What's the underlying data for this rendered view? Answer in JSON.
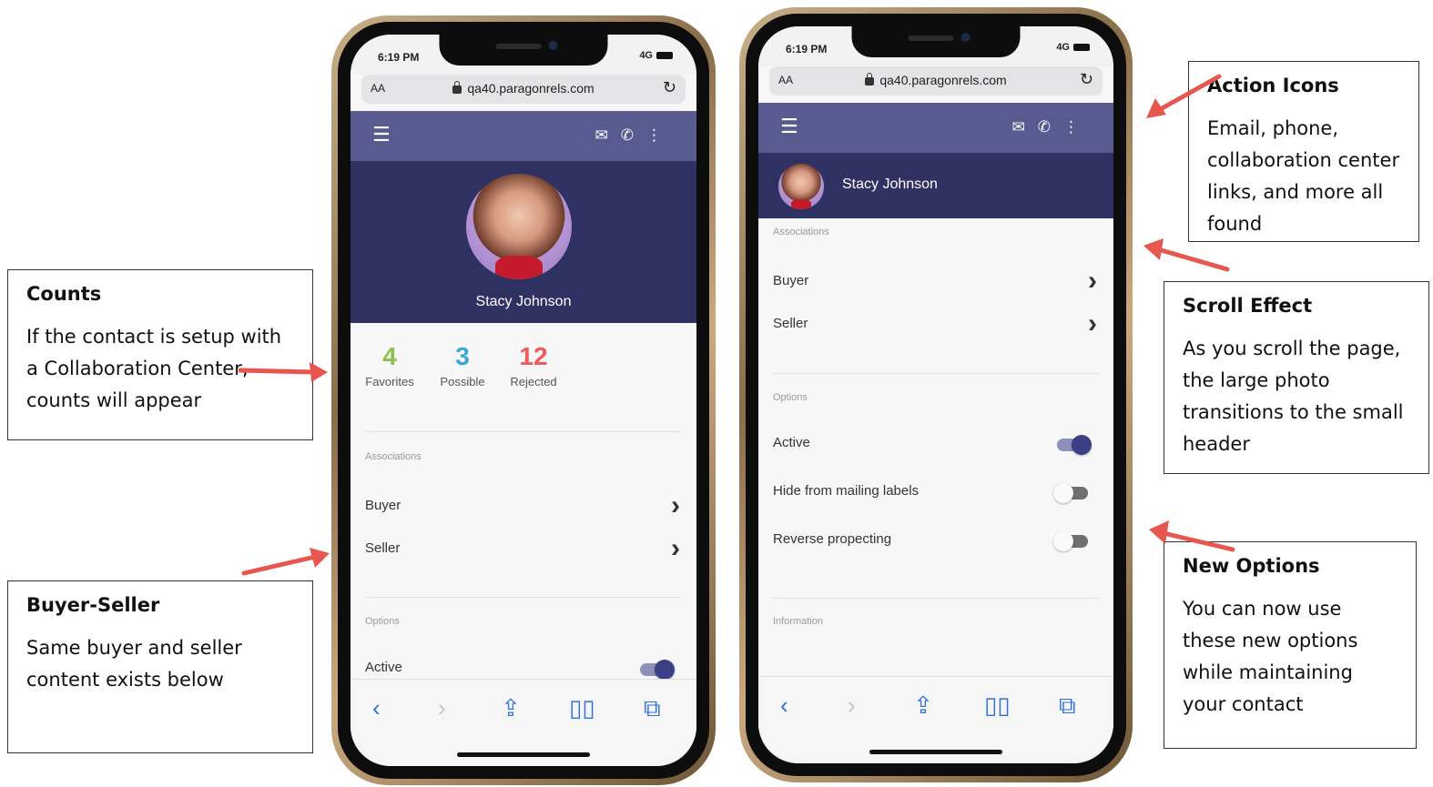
{
  "callouts": {
    "counts": {
      "title": "Counts",
      "text": "If the contact is setup with a Collaboration Center, counts will appear"
    },
    "buyer_seller": {
      "title": "Buyer-Seller",
      "text": "Same buyer and seller content exists below"
    },
    "action_icons": {
      "title": "Action Icons",
      "text": "Email, phone, collaboration center links, and more all found"
    },
    "scroll_effect": {
      "title": "Scroll Effect",
      "text": "As you scroll the page, the large photo transitions to the small header"
    },
    "new_options": {
      "title": "New Options",
      "text": "You can now use these new options while maintaining your contact"
    }
  },
  "status": {
    "time": "6:19 PM",
    "signal": "4G"
  },
  "browser": {
    "aa": "AA",
    "url": "qa40.paragonrels.com"
  },
  "contact": {
    "name": "Stacy Johnson"
  },
  "counts": {
    "favorites": {
      "value": "4",
      "label": "Favorites",
      "color": "#8bc34a"
    },
    "possible": {
      "value": "3",
      "label": "Possible",
      "color": "#3aa7d8"
    },
    "rejected": {
      "value": "12",
      "label": "Rejected",
      "color": "#ef5a5a"
    }
  },
  "sections": {
    "associations": "Associations",
    "options": "Options",
    "information": "Information"
  },
  "associations": {
    "buyer": "Buyer",
    "seller": "Seller"
  },
  "options": {
    "active": {
      "label": "Active",
      "on": true
    },
    "hide_mailing": {
      "label": "Hide from mailing labels",
      "on": false
    },
    "reverse": {
      "label": "Reverse propecting",
      "on": false
    }
  },
  "colors": {
    "appbar": "#575b8f",
    "hero": "#2f3163",
    "arrow": "#e8574f",
    "link": "#2f6fe0"
  },
  "icons": [
    "menu-icon",
    "mail-icon",
    "phone-icon",
    "more-vert-icon",
    "back-icon",
    "forward-icon",
    "share-icon",
    "bookmarks-icon",
    "tabs-icon",
    "lock-icon",
    "reload-icon"
  ]
}
